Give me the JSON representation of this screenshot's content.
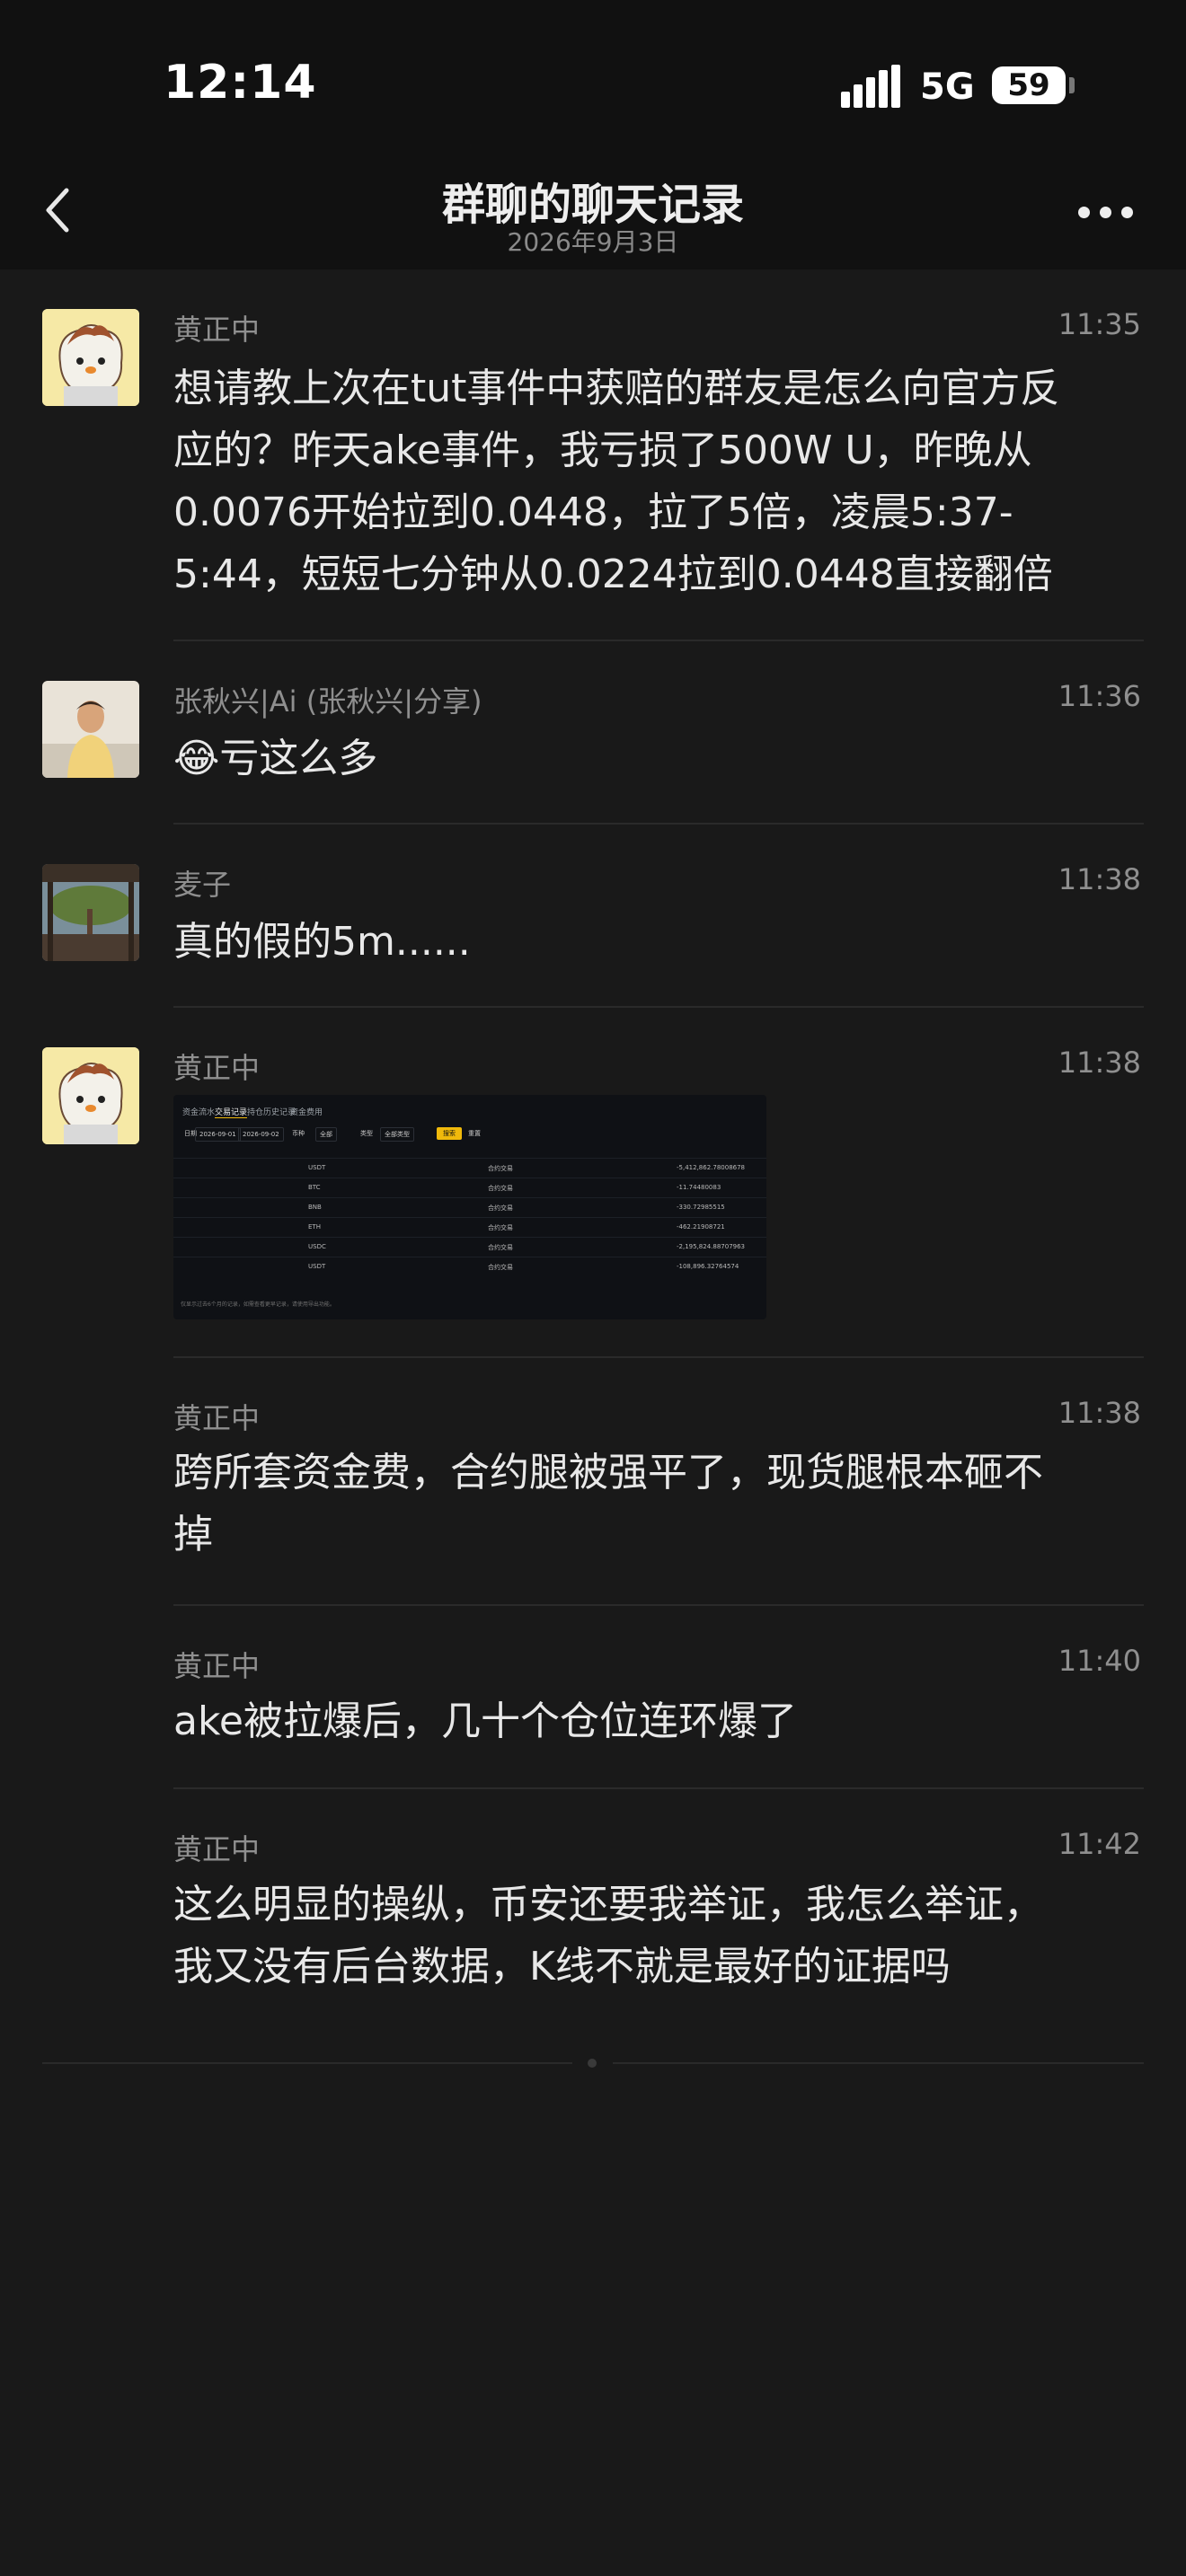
{
  "status": {
    "time": "12:14",
    "network": "5G",
    "battery": "59"
  },
  "nav": {
    "title": "群聊的聊天记录",
    "date": "2026年9月3日"
  },
  "messages": [
    {
      "sender": "黄正中",
      "time": "11:35",
      "lines": [
        "想请教上次在tut事件中获赔的群友是怎么向官方反",
        "应的？昨天ake事件，我亏损了500W U，昨晚从",
        "0.0076开始拉到0.0448，拉了5倍，凌晨5:37-",
        "5:44，短短七分钟从0.0224拉到0.0448直接翻倍"
      ]
    },
    {
      "sender": "张秋兴|Ai (张秋兴|分享)",
      "time": "11:36",
      "lines": [
        "😂亏这么多"
      ]
    },
    {
      "sender": "麦子",
      "time": "11:38",
      "lines": [
        "真的假的5m......"
      ]
    },
    {
      "sender": "黄正中",
      "time": "11:38",
      "image": true
    },
    {
      "sender": "黄正中",
      "time": "11:38",
      "lines": [
        "跨所套资金费，合约腿被强平了，现货腿根本砸不",
        "掉"
      ]
    },
    {
      "sender": "黄正中",
      "time": "11:40",
      "lines": [
        "ake被拉爆后，几十个仓位连环爆了"
      ]
    },
    {
      "sender": "黄正中",
      "time": "11:42",
      "lines": [
        "这么明显的操纵，币安还要我举证，我怎么举证，",
        "我又没有后台数据，K线不就是最好的证据吗"
      ]
    }
  ],
  "screenshot": {
    "tabs": [
      "资金流水",
      "交易记录",
      "持仓历史记录",
      "资金费用"
    ],
    "filters": [
      "日期",
      "2026-09-01",
      "2026-09-02",
      "币种",
      "全部",
      "类型",
      "全部类型",
      "搜索",
      "重置"
    ],
    "rows": [
      {
        "asset": "USDT",
        "type": "合约交易",
        "amount": "-5,412,862.78008678"
      },
      {
        "asset": "BTC",
        "type": "合约交易",
        "amount": "-11.74480083"
      },
      {
        "asset": "BNB",
        "type": "合约交易",
        "amount": "-330.72985515"
      },
      {
        "asset": "ETH",
        "type": "合约交易",
        "amount": "-462.21908721"
      },
      {
        "asset": "USDC",
        "type": "合约交易",
        "amount": "-2,195,824.88707963"
      },
      {
        "asset": "USDT",
        "type": "合约交易",
        "amount": "-108,896.32764574"
      }
    ],
    "footnote": "仅显示过去6个月的记录，如需查看更早记录，请使用导出功能。"
  }
}
